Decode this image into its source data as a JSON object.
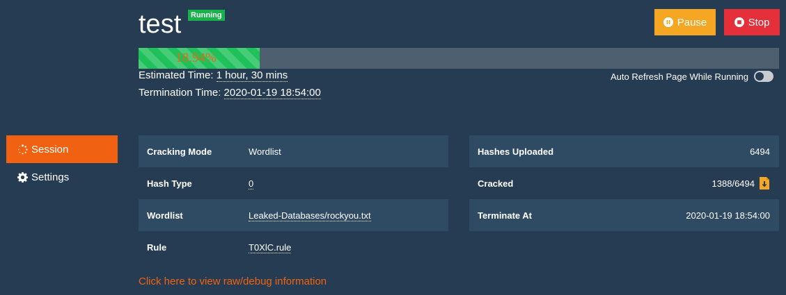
{
  "sidebar": {
    "items": [
      {
        "label": "Session",
        "icon": "spinner-icon",
        "active": true
      },
      {
        "label": "Settings",
        "icon": "gear-icon",
        "active": false
      }
    ]
  },
  "header": {
    "title": "test",
    "status_badge": "Running",
    "pause_label": "Pause",
    "stop_label": "Stop"
  },
  "progress": {
    "percent": 18.94,
    "label": "18.94%"
  },
  "estimated": {
    "label": "Estimated Time:",
    "value": "1 hour, 30 mins"
  },
  "termination": {
    "label": "Termination Time:",
    "value": "2020-01-19 18:54:00"
  },
  "auto_refresh": {
    "label": "Auto Refresh Page While Running",
    "enabled": false
  },
  "left_table": [
    {
      "key": "Cracking Mode",
      "value": "Wordlist"
    },
    {
      "key": "Hash Type",
      "value": "0"
    },
    {
      "key": "Wordlist",
      "value": "Leaked-Databases/rockyou.txt"
    },
    {
      "key": "Rule",
      "value": "T0XlC.rule"
    }
  ],
  "right_table": [
    {
      "key": "Hashes Uploaded",
      "value": "6494"
    },
    {
      "key": "Cracked",
      "value": "1388/6494"
    },
    {
      "key": "Terminate At",
      "value": "2020-01-19 18:54:00"
    }
  ],
  "debug_link": "Click here to view raw/debug information",
  "colors": {
    "background": "#263c52",
    "accent": "#f06212",
    "running": "#18b24b",
    "pause": "#f5a623",
    "stop": "#e5303b"
  }
}
